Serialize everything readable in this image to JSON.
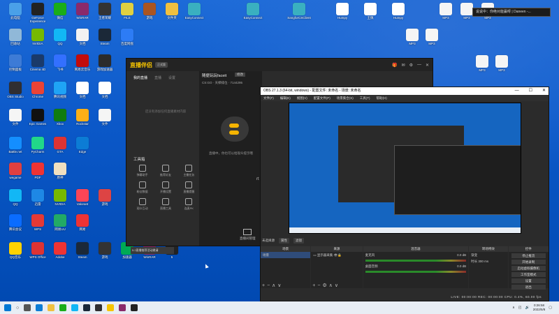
{
  "desktop_icons": [
    {
      "label": "此电脑",
      "color": "#4aa0e8"
    },
    {
      "label": "GeForce Experience",
      "color": "#222"
    },
    {
      "label": "微信",
      "color": "#1aad19"
    },
    {
      "label": "WinRAR",
      "color": "#8a2a6a"
    },
    {
      "label": "王者荣耀",
      "color": "#333"
    },
    {
      "label": "FILE",
      "color": "#e0d040"
    },
    {
      "label": "游戏",
      "color": "#aa5522"
    },
    {
      "label": "文件夹",
      "color": "#f0c040"
    },
    {
      "label": "EasyConnect",
      "color": "#3ab0c0"
    },
    {
      "label": "回收站",
      "color": "#90b8d8"
    },
    {
      "label": "NVIDIA",
      "color": "#76b900"
    },
    {
      "label": "QQ",
      "color": "#12b7f5"
    },
    {
      "label": "文档",
      "color": "#f2f2f2"
    },
    {
      "label": "Steam",
      "color": "#1b2838"
    },
    {
      "label": "百度网盘",
      "color": "#2d7cf5"
    },
    {
      "label": "控制面板",
      "color": "#3d7bd6"
    },
    {
      "label": "Cinema 4D",
      "color": "#1a3a6a"
    },
    {
      "label": "飞书",
      "color": "#3370ff"
    },
    {
      "label": "网易云音乐",
      "color": "#c20c0c"
    },
    {
      "label": "游戏加速器",
      "color": "#2b2b2b"
    },
    {
      "label": "OBS Studio",
      "color": "#302e31"
    },
    {
      "label": "Chrome",
      "color": "#ea4335"
    },
    {
      "label": "腾讯视频",
      "color": "#1fa3f5"
    },
    {
      "label": "文档",
      "color": "#ffffff"
    },
    {
      "label": "文档",
      "color": "#ffffff"
    },
    {
      "label": "文件",
      "color": "#f5f5f5"
    },
    {
      "label": "Epic Games",
      "color": "#111"
    },
    {
      "label": "Xbox",
      "color": "#107c10"
    },
    {
      "label": "Rockstar",
      "color": "#fcaf17"
    },
    {
      "label": "文件",
      "color": "#f5f5f5"
    },
    {
      "label": "Battle.net",
      "color": "#148eff"
    },
    {
      "label": "PyCharm",
      "color": "#21d789"
    },
    {
      "label": "GTA",
      "color": "#d33"
    },
    {
      "label": "Edge",
      "color": "#0c7cd5"
    },
    {
      "label": "wegame",
      "color": "#e04040"
    },
    {
      "label": "PDF",
      "color": "#e33"
    },
    {
      "label": "原神",
      "color": "#f0e0c0"
    },
    {
      "label": "QQ",
      "color": "#12b7f5"
    },
    {
      "label": "迅雷",
      "color": "#1e88e5"
    },
    {
      "label": "NVIDIA",
      "color": "#76b900"
    },
    {
      "label": "Valorant",
      "color": "#fd4556"
    },
    {
      "label": "游戏",
      "color": "#d44"
    },
    {
      "label": "腾讯会议",
      "color": "#0a6cff"
    },
    {
      "label": "WPS",
      "color": "#e53935"
    },
    {
      "label": "网易UU",
      "color": "#2a6"
    },
    {
      "label": "网易",
      "color": "#e33"
    },
    {
      "label": "QQ音乐",
      "color": "#ffd200"
    },
    {
      "label": "WPS Office",
      "color": "#d33"
    },
    {
      "label": "Adobe",
      "color": "#e33"
    },
    {
      "label": "Steam",
      "color": "#1b2838"
    },
    {
      "label": "游戏",
      "color": "#333"
    },
    {
      "label": "加速器",
      "color": "#0a5"
    },
    {
      "label": "WinRAR",
      "color": "#8a2a6a"
    },
    {
      "label": "5",
      "color": "#222"
    },
    {
      "label": "EasyConnect",
      "color": "#3ab0c0"
    },
    {
      "label": "SangforCSClient",
      "color": "#3ab0c0"
    },
    {
      "label": "Humpy",
      "color": "#fff"
    },
    {
      "label": "王佩",
      "color": "#fff"
    },
    {
      "label": "Humpy",
      "color": "#fff"
    },
    {
      "label": "MP3",
      "color": "#f5f5f5"
    },
    {
      "label": "MP3",
      "color": "#f5f5f5"
    },
    {
      "label": "MP3",
      "color": "#f5f5f5"
    },
    {
      "label": "MP3",
      "color": "#f5f5f5"
    },
    {
      "label": "MP3",
      "color": "#f5f5f5"
    },
    {
      "label": "MP3",
      "color": "#f5f5f5"
    },
    {
      "label": "MP3",
      "color": "#f5f5f5"
    }
  ],
  "notification": "说说中：你绝对能赢呀 | Daneen -...",
  "zhibo": {
    "logo": "直播伴侣",
    "version": "正式版",
    "tabs": [
      "我的直播",
      "直播",
      "设置"
    ],
    "empty_text": "还没有添加任何直播素材内容",
    "tools_title": "工具箱",
    "tools": [
      "弹幕助手",
      "推荐好友",
      "主播任务",
      "粉丝数据",
      "开播设置",
      "直播提醒",
      "观众互动",
      "直播工具",
      "连麦PK"
    ],
    "banner": "5.2直播推荐活动邀请",
    "stream_title": "随便玩玩faceit",
    "edit": "修改",
    "meta": "CS:GO · 天梯排位",
    "viewers": "7144295",
    "preview_text": "直播中，你也可以给观众提示哦",
    "rt": "rt",
    "room": "直播间管理"
  },
  "obs": {
    "title": "OBS 27.1.3 (64-bit, windows) - 配置文件: 未命名 - 场景: 未命名",
    "menu": [
      "文件(F)",
      "编辑(E)",
      "视图(V)",
      "配置文件(P)",
      "场景集合(S)",
      "工具(T)",
      "帮助(H)"
    ],
    "controls": [
      "未选择源",
      "属性",
      "滤镜"
    ],
    "docks": {
      "scenes": {
        "title": "场景",
        "items": [
          "场景"
        ]
      },
      "sources": {
        "title": "来源",
        "items": [
          "显示器采集"
        ]
      },
      "mixer": {
        "title": "混音器",
        "tracks": [
          {
            "name": "麦克风",
            "level": "0.0 dB"
          },
          {
            "name": "桌面音频",
            "level": "0.0 dB"
          }
        ]
      },
      "transitions": {
        "title": "转场特效",
        "mode": "渐变",
        "duration_label": "时长",
        "duration": "300 ms"
      },
      "controls": {
        "title": "控件",
        "buttons": [
          "停止推流",
          "开始录制",
          "启动虚拟摄像机",
          "工作室模式",
          "设置",
          "退出"
        ]
      }
    },
    "status": "LIVE: 00:00:00    REC: 00:00:00    CPU: 0.4%, 60.00 fps"
  },
  "taskbar": {
    "search": "○",
    "time": "0:26:58",
    "date": "2022/5/8"
  }
}
